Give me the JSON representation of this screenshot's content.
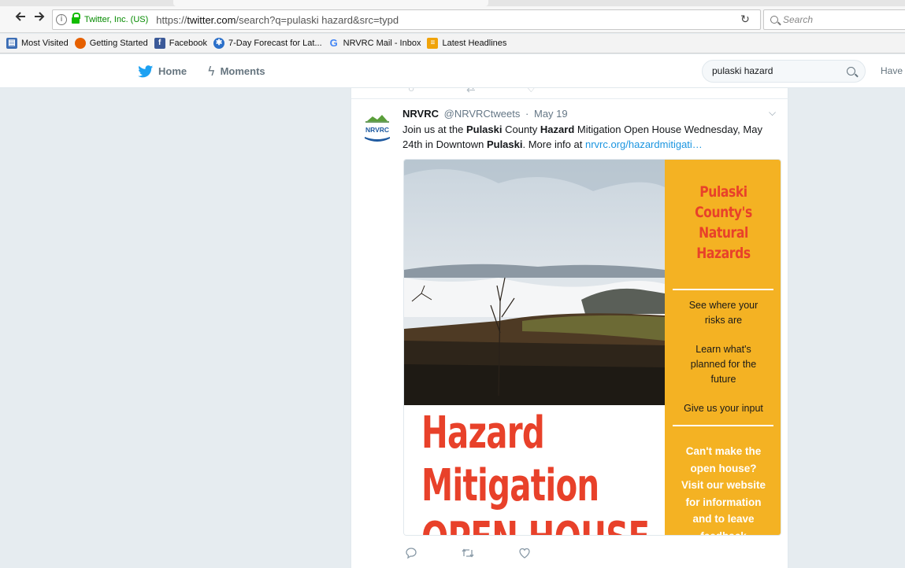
{
  "browser": {
    "identity": "Twitter, Inc. (US)",
    "url_prefix": "https://",
    "url_host": "twitter.com",
    "url_path": "/search?q=pulaski hazard&src=typd",
    "search_placeholder": "Search",
    "back_icon": "back-arrow-icon",
    "forward_icon": "forward-arrow-icon",
    "reload_icon": "reload-icon"
  },
  "bookmarks": [
    {
      "label": "Most Visited",
      "icon": "most-visited-icon",
      "color": "#3d6eb5"
    },
    {
      "label": "Getting Started",
      "icon": "firefox-icon",
      "color": "#e66000"
    },
    {
      "label": "Facebook",
      "icon": "facebook-icon",
      "color": "#3b5998"
    },
    {
      "label": "7-Day Forecast for Lat...",
      "icon": "weather-icon",
      "color": "#2a6fc9"
    },
    {
      "label": "NRVRC Mail - Inbox",
      "icon": "google-icon",
      "color": "#4285f4"
    },
    {
      "label": "Latest Headlines",
      "icon": "rss-feed-icon",
      "color": "#f0a30a"
    }
  ],
  "twitter_nav": {
    "home_label": "Home",
    "moments_label": "Moments",
    "search_value": "pulaski hazard",
    "account_prompt": "Have a"
  },
  "tweet": {
    "name": "NRVRC",
    "handle": "@NRVRCtweets",
    "separator": "·",
    "date": "May 19",
    "avatar_text": "NRVRC",
    "text_segments": {
      "t1": "Join us at the ",
      "b1": "Pulaski",
      "t2": " County ",
      "b2": "Hazard",
      "t3": " Mitigation Open House Wednesday, May 24th in Downtown ",
      "b3": "Pulaski",
      "t4": ". More info at ",
      "link": "nrvrc.org/hazardmitigati…"
    },
    "media": {
      "panel_title_lines": [
        "Pulaski",
        "County's",
        "Natural",
        "Hazards"
      ],
      "panel_text_1": [
        "See where your",
        "risks are"
      ],
      "panel_text_2": [
        "Learn what's",
        "planned for the",
        "future"
      ],
      "panel_text_3": "Give us your input",
      "panel_cta_lines": [
        "Can't make the",
        "open house?",
        "Visit our website",
        "for information",
        "and to leave",
        "feedback"
      ],
      "big_title_lines": [
        "Hazard",
        "Mitigation",
        "OPEN HOUSE"
      ]
    }
  },
  "colors": {
    "panel_orange": "#f4b223",
    "title_red": "#e8412a",
    "twitter_blue": "#1da1f2",
    "link_blue": "#1b95e0"
  }
}
